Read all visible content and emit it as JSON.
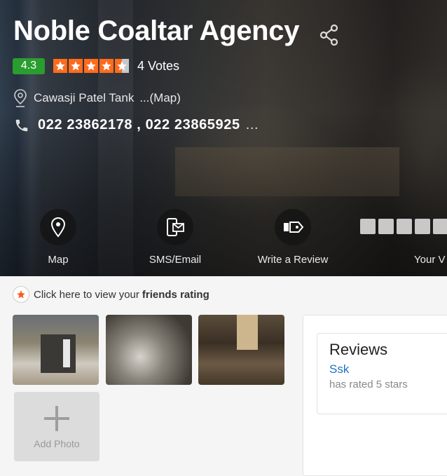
{
  "business": {
    "name": "Noble Coaltar Agency",
    "rating": "4.3",
    "votes": "4 Votes",
    "address": "Cawasji Patel Tank",
    "map_link": "...(Map)",
    "phone": "022 23862178 , 022 23865925",
    "phone_more": "..."
  },
  "stars": {
    "rating_value": 4.5,
    "max": 5
  },
  "actions": {
    "map": "Map",
    "sms_email": "SMS/Email",
    "write_review": "Write a Review",
    "your": "Your V"
  },
  "friends": {
    "prefix": "Click here to view your",
    "bold": "friends rating"
  },
  "photos": {
    "add_label": "Add Photo"
  },
  "reviews": {
    "heading": "Reviews",
    "user": "Ssk",
    "rated": "has rated 5 stars"
  },
  "colors": {
    "rating_badge": "#2a9d2f",
    "star": "#ff6b1c",
    "link": "#1a73c8"
  }
}
